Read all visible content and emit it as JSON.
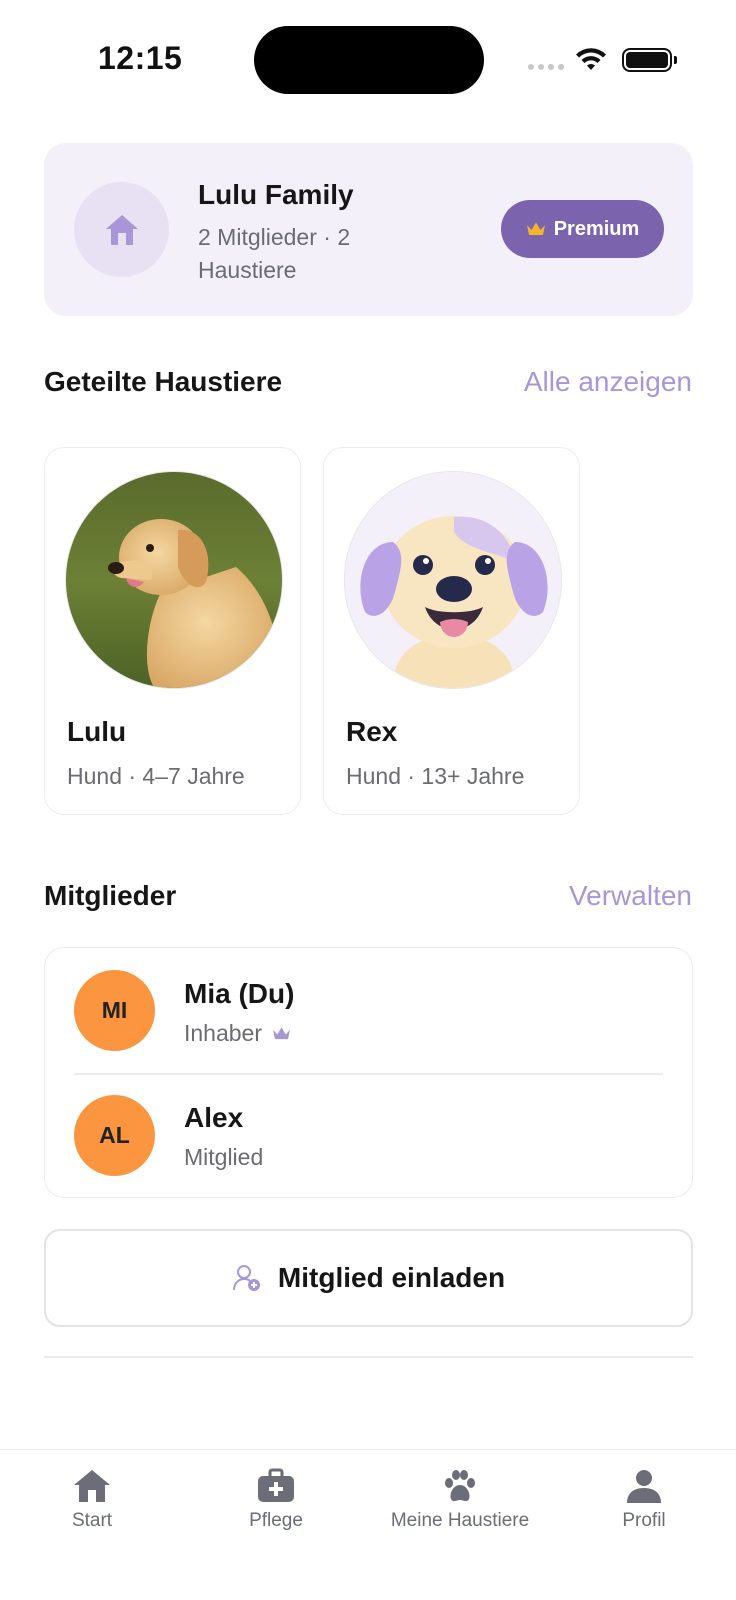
{
  "status_bar": {
    "time": "12:15"
  },
  "family": {
    "name": "Lulu Family",
    "meta": "2 Mitglieder · 2 Haustiere",
    "premium_label": "Premium",
    "icon": "house-icon"
  },
  "pets_section": {
    "title": "Geteilte Haustiere",
    "link": "Alle anzeigen",
    "pets": [
      {
        "name": "Lulu",
        "meta": "Hund · 4–7 Jahre",
        "image": "golden-retriever-photo"
      },
      {
        "name": "Rex",
        "meta": "Hund · 13+ Jahre",
        "image": "cartoon-puppy-illustration"
      }
    ]
  },
  "members_section": {
    "title": "Mitglieder",
    "link": "Verwalten",
    "members": [
      {
        "initials": "MI",
        "name": "Mia (Du)",
        "role": "Inhaber",
        "role_icon": "crown-icon"
      },
      {
        "initials": "AL",
        "name": "Alex",
        "role": "Mitglied"
      }
    ]
  },
  "invite_button": {
    "label": "Mitglied einladen",
    "icon": "add-user-icon"
  },
  "tab_bar": {
    "tabs": [
      {
        "label": "Start",
        "icon": "house-icon"
      },
      {
        "label": "Pflege",
        "icon": "medical-kit-icon"
      },
      {
        "label": "Meine Haustiere",
        "icon": "paw-icon"
      },
      {
        "label": "Profil",
        "icon": "person-icon"
      }
    ]
  },
  "colors": {
    "accent": "#7b63ae",
    "accent_light": "#a896d8",
    "card_bg": "#f3f0f9",
    "avatar_orange": "#fb9540",
    "crown_gold": "#f5b52a"
  }
}
